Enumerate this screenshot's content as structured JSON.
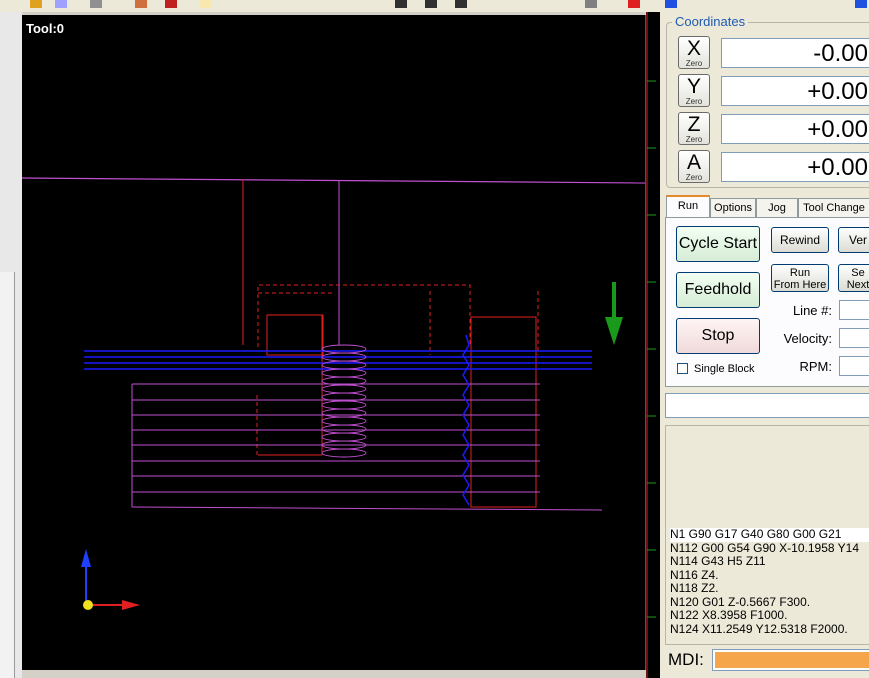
{
  "viewport": {
    "tool_label": "Tool:0"
  },
  "coordinates": {
    "title": "Coordinates",
    "zero_label": "Zero",
    "axes": [
      {
        "axis": "X",
        "value": "-0.00"
      },
      {
        "axis": "Y",
        "value": "+0.00"
      },
      {
        "axis": "Z",
        "value": "+0.00"
      },
      {
        "axis": "A",
        "value": "+0.00"
      }
    ]
  },
  "tabs": [
    {
      "label": "Run",
      "active": true
    },
    {
      "label": "Options",
      "active": false
    },
    {
      "label": "Jog",
      "active": false
    },
    {
      "label": "Tool Change",
      "active": false
    }
  ],
  "run": {
    "cycle_start": "Cycle Start",
    "feedhold": "Feedhold",
    "stop": "Stop",
    "rewind": "Rewind",
    "verify": "Ver",
    "run_from_here_1": "Run",
    "run_from_here_2": "From Here",
    "set_next_1": "Se",
    "set_next_2": "Next",
    "single_block": "Single Block",
    "line_label": "Line #:",
    "velocity_label": "Velocity:",
    "rpm_label": "RPM:"
  },
  "gcode_lines": [
    "N1 G90 G17 G40 G80 G00 G21",
    "N112 G00 G54 G90 X-10.1958 Y14",
    "N114 G43 H5 Z11",
    "N116 Z4.",
    "N118 Z2.",
    "N120 G01 Z-0.5667 F300.",
    "N122 X8.3958 F1000.",
    "N124 X11.2549 Y12.5318 F2000."
  ],
  "mdi": {
    "label": "MDI:"
  },
  "colors": {
    "viewport_bg": "#000000",
    "toolpath_magenta": "#c050d0",
    "toolpath_red": "#e02020",
    "toolpath_blue": "#1a1aff",
    "arrow_green": "#1a9a1a",
    "accent_blue": "#1e5ab4",
    "mdi_fill": "#f5a54a"
  }
}
